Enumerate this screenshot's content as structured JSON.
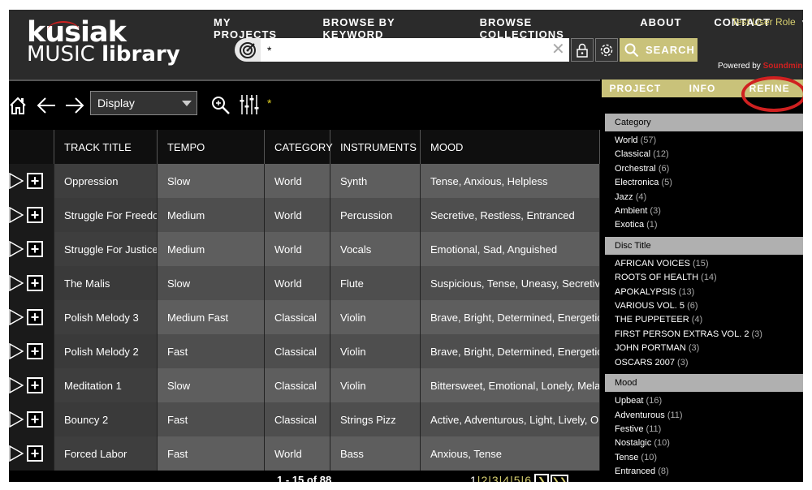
{
  "header": {
    "logo_top": "kusiak",
    "logo_music": "MUSIC ",
    "logo_library": "library",
    "nav": [
      "MY PROJECTS",
      "BROWSE BY KEYWORD",
      "BROWSE COLLECTIONS",
      "ABOUT",
      "CONTACT"
    ],
    "user_role": "Test User Role",
    "search_value": "*",
    "search_label": "SEARCH",
    "powered_prefix": "Powered by ",
    "powered_brand": "Soundmine"
  },
  "toolbar": {
    "display_value": "Display",
    "query_indicator": "*"
  },
  "table": {
    "columns": [
      "",
      "TRACK TITLE",
      "TEMPO",
      "CATEGORY",
      "INSTRUMENTS",
      "MOOD"
    ],
    "rows": [
      {
        "title": "Oppression",
        "tempo": "Slow",
        "category": "World",
        "instruments": "Synth",
        "mood": "Tense, Anxious, Helpless"
      },
      {
        "title": "Struggle For Freedo",
        "tempo": "Medium",
        "category": "World",
        "instruments": "Percussion",
        "mood": "Secretive, Restless, Entranced"
      },
      {
        "title": "Struggle For Justice",
        "tempo": "Medium",
        "category": "World",
        "instruments": "Vocals",
        "mood": "Emotional, Sad, Anguished"
      },
      {
        "title": "The Malis",
        "tempo": "Slow",
        "category": "World",
        "instruments": "Flute",
        "mood": "Suspicious, Tense, Uneasy, Secretive"
      },
      {
        "title": "Polish Melody 3",
        "tempo": "Medium Fast",
        "category": "Classical",
        "instruments": "Violin",
        "mood": "Brave, Bright, Determined, Energetic,"
      },
      {
        "title": "Polish Melody 2",
        "tempo": "Fast",
        "category": "Classical",
        "instruments": "Violin",
        "mood": "Brave, Bright, Determined, Energetic,"
      },
      {
        "title": "Meditation 1",
        "tempo": "Slow",
        "category": "Classical",
        "instruments": "Violin",
        "mood": "Bittersweet, Emotional, Lonely, Melan"
      },
      {
        "title": "Bouncy 2",
        "tempo": "Fast",
        "category": "Classical",
        "instruments": "Strings Pizz",
        "mood": "Active, Adventurous, Light, Lively, Op"
      },
      {
        "title": "Forced Labor",
        "tempo": "Fast",
        "category": "World",
        "instruments": "Bass",
        "mood": "Anxious, Tense"
      }
    ]
  },
  "pager": {
    "range": "1 - 15",
    "of_label": " of ",
    "total": "88",
    "pages": [
      "1",
      "2",
      "3",
      "4",
      "5",
      "6"
    ]
  },
  "panel": {
    "tabs": [
      "PROJECT",
      "INFO",
      "REFINE"
    ],
    "sections": [
      {
        "title": "Category",
        "items": [
          {
            "label": "World",
            "count": "(57)"
          },
          {
            "label": "Classical",
            "count": "(12)"
          },
          {
            "label": "Orchestral",
            "count": "(6)"
          },
          {
            "label": "Electronica",
            "count": "(5)"
          },
          {
            "label": "Jazz",
            "count": "(4)"
          },
          {
            "label": "Ambient",
            "count": "(3)"
          },
          {
            "label": "Exotica",
            "count": "(1)"
          }
        ]
      },
      {
        "title": "Disc Title",
        "items": [
          {
            "label": "AFRICAN VOICES",
            "count": "(15)"
          },
          {
            "label": "ROOTS OF HEALTH",
            "count": "(14)"
          },
          {
            "label": "APOKALYPSIS",
            "count": "(13)"
          },
          {
            "label": "VARIOUS VOL. 5",
            "count": "(6)"
          },
          {
            "label": "THE PUPPETEER",
            "count": "(4)"
          },
          {
            "label": "FIRST PERSON EXTRAS VOL. 2",
            "count": "(3)"
          },
          {
            "label": "JOHN PORTMAN",
            "count": "(3)"
          },
          {
            "label": "OSCARS 2007",
            "count": "(3)"
          }
        ]
      },
      {
        "title": "Mood",
        "items": [
          {
            "label": "Upbeat",
            "count": "(16)"
          },
          {
            "label": "Adventurous",
            "count": "(11)"
          },
          {
            "label": "Festive",
            "count": "(11)"
          },
          {
            "label": "Nostalgic",
            "count": "(10)"
          },
          {
            "label": "Tense",
            "count": "(10)"
          },
          {
            "label": "Entranced",
            "count": "(8)"
          }
        ]
      }
    ]
  },
  "colors": {
    "accent": "#c9c27a",
    "highlight_circle": "#d02020",
    "link": "#d8d070"
  },
  "icons": [
    "target-icon",
    "clear-icon",
    "lock-icon",
    "gear-icon",
    "search-icon",
    "home-icon",
    "back-arrow-icon",
    "forward-arrow-icon",
    "zoom-icon",
    "sliders-icon",
    "play-icon",
    "add-icon",
    "next-page-icon",
    "last-page-icon"
  ]
}
